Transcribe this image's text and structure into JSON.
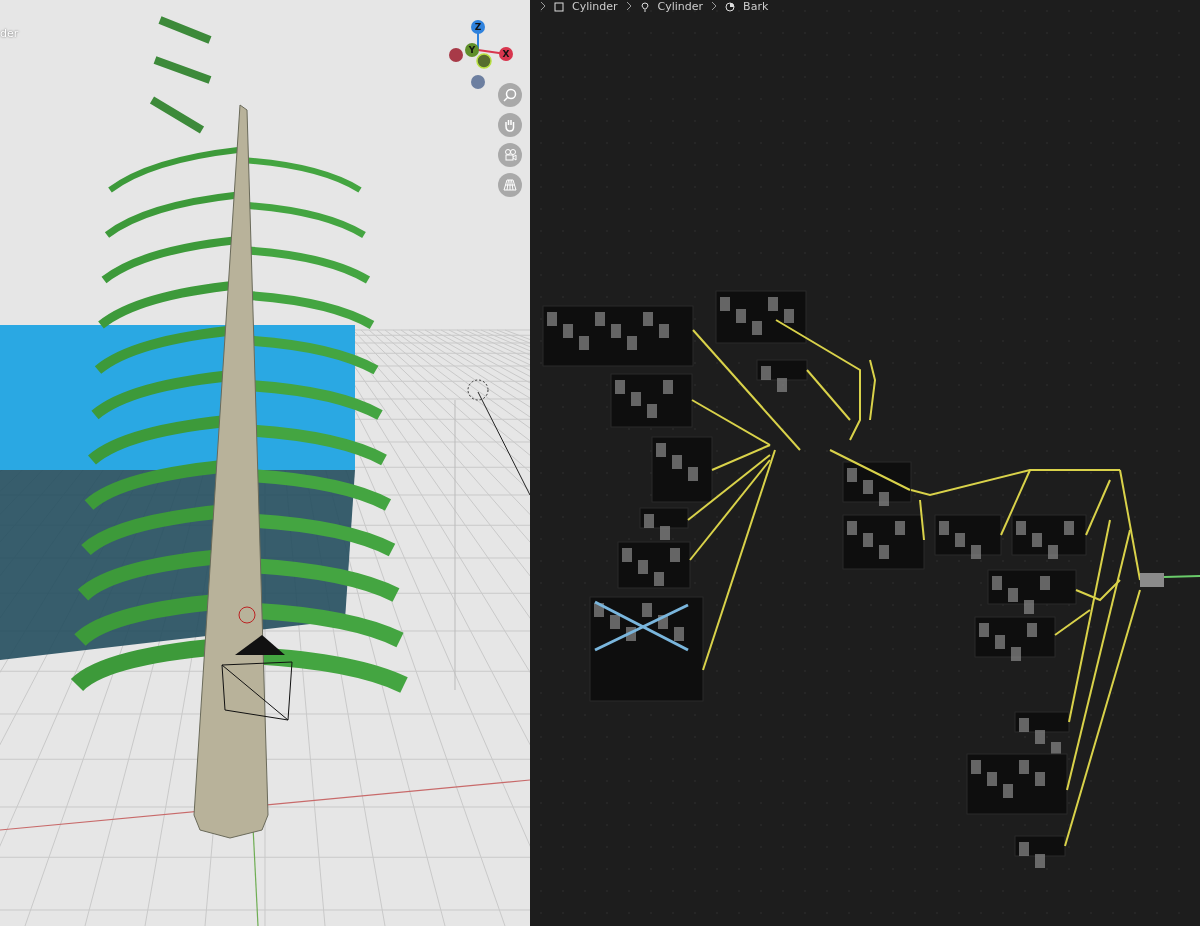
{
  "viewport": {
    "header_text": "der",
    "gizmo_axes": [
      {
        "label": "Z",
        "kind": "z"
      },
      {
        "label": "Y",
        "kind": "y"
      },
      {
        "label": "X",
        "kind": "x"
      }
    ]
  },
  "node_editor": {
    "breadcrumbs": [
      {
        "label": "Cylinder",
        "kind": "object"
      },
      {
        "label": "Cylinder",
        "kind": "mesh"
      },
      {
        "label": "Bark",
        "kind": "material"
      }
    ]
  }
}
